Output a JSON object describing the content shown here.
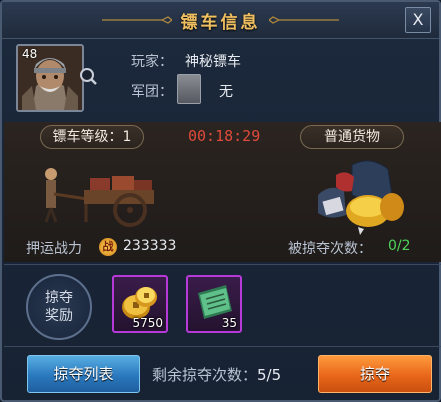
{
  "window": {
    "title": "镖车信息",
    "close_label": "X"
  },
  "player": {
    "level": "48",
    "player_label": "玩家：",
    "player_name": "神秘镖车",
    "guild_label": "军团：",
    "guild_value": "无"
  },
  "cart": {
    "level_label": "镖车等级：1",
    "countdown": "00:18:29",
    "cargo_type": "普通货物",
    "escort_power_label": "押运战力",
    "escort_power_icon": "战",
    "escort_power_value": "233333",
    "robbed_count_label": "被掠夺次数：",
    "robbed_count_value": "0/2"
  },
  "rewards": {
    "label_line1": "掠夺",
    "label_line2": "奖励",
    "items": [
      {
        "icon": "gold-coins-icon",
        "count": "5750"
      },
      {
        "icon": "green-book-icon",
        "count": "35"
      }
    ]
  },
  "footer": {
    "rob_list_button": "掠夺列表",
    "remaining_label": "剩余掠夺次数：",
    "remaining_value": "5/5",
    "rob_button": "掠夺"
  },
  "colors": {
    "title_gold": "#f0c060",
    "countdown_red": "#e04a3a",
    "robbed_green": "#4fd25a",
    "item_border_purple": "#b53ad8",
    "button_blue": "#2a78bd",
    "button_orange": "#e8661a"
  }
}
